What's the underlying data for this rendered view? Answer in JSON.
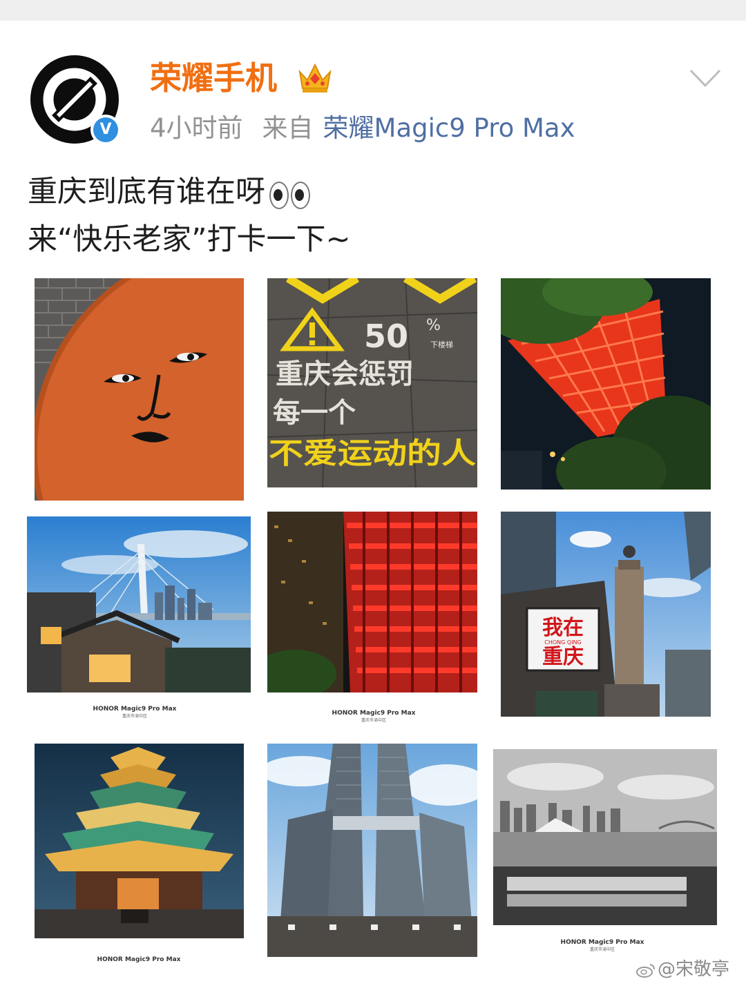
{
  "post": {
    "username": "荣耀手机",
    "time": "4小时前",
    "source_prefix": "来自",
    "device": "荣耀Magic9 Pro Max",
    "text_line1": "重庆到底有谁在呀",
    "text_line2": "来“快乐老家”打卡一下~"
  },
  "icons": {
    "avatar": "honor-logo",
    "verified": "verified-v-badge",
    "crown": "crown-icon",
    "menu": "chevron-down-icon",
    "eyes": "eyes-emoji"
  },
  "verified_badge": "V",
  "photos": {
    "p2_sign": {
      "percent": "50",
      "percent_sign": "%",
      "small_tag": "下楼梯",
      "line1": "重庆会惩罚",
      "line2": "每一个",
      "line3": "不爱运动的人"
    },
    "p6_billboard": {
      "line1": "我在",
      "line2": "CHONG QING",
      "line3": "重庆"
    },
    "captions": [
      {
        "device": "HONOR Magic9 Pro Max",
        "location": "重庆市渝中区"
      },
      {
        "device": "HONOR Magic9 Pro Max",
        "location": "重庆市渝中区"
      },
      {
        "device": "HONOR Magic9 Pro Max",
        "location": ""
      },
      {
        "device": "HONOR Magic9 Pro Max",
        "location": "重庆市渝中区"
      }
    ]
  },
  "watermark": "@宋敬亭",
  "colors": {
    "username": "#f06f12",
    "device_link": "#4f6fa3",
    "meta_gray": "#929292",
    "verified_blue": "#2f8fe0"
  }
}
